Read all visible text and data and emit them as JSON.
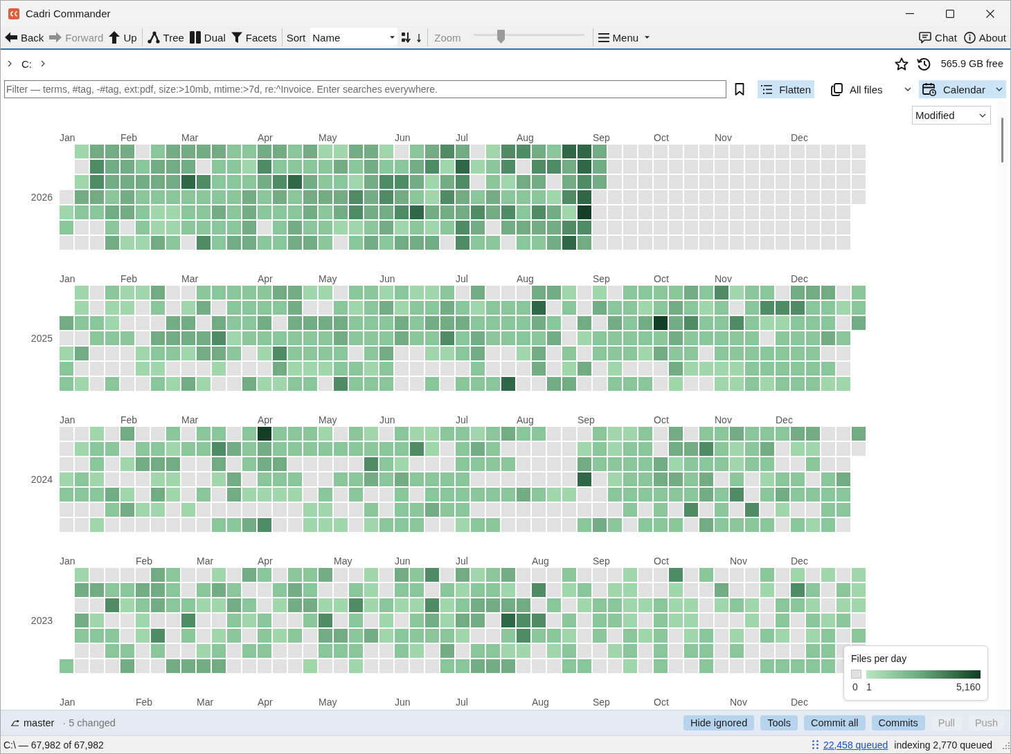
{
  "window": {
    "title": "Cadri Commander"
  },
  "toolbar": {
    "nav": [
      {
        "label": "Back",
        "disabled": false
      },
      {
        "label": "Forward",
        "disabled": true
      },
      {
        "label": "Up",
        "disabled": false
      }
    ],
    "views": [
      {
        "label": "Tree"
      },
      {
        "label": "Dual"
      },
      {
        "label": "Facets"
      }
    ],
    "sort": {
      "label": "Sort",
      "value": "Name"
    },
    "zoom": {
      "label": "Zoom",
      "disabled": true,
      "level": 0.23
    },
    "menu": {
      "label": "Menu"
    },
    "links": [
      {
        "label": "Chat"
      },
      {
        "label": "About"
      }
    ]
  },
  "location": {
    "path": [
      {
        "label": "C:"
      }
    ],
    "free_space": "565.9 GB free"
  },
  "filter": {
    "placeholder": "Filter — terms, #tag, -#tag, ext:pdf, size:>10mb, mtime:>7d, re:^Invoice. Enter searches everywhere."
  },
  "options": [
    {
      "kind": "toggle",
      "label": "Flatten",
      "on": true
    },
    {
      "kind": "dropdown",
      "label": "All files",
      "on": false
    },
    {
      "kind": "dropdown",
      "label": "Calendar",
      "on": true
    }
  ],
  "calendar": {
    "date_field": "Modified",
    "years": [
      {
        "year": "2026",
        "months": [
          "Jan",
          "Feb",
          "Mar",
          "Apr",
          "May",
          "Jun",
          "Jul",
          "Aug",
          "Sep",
          "Oct",
          "Nov",
          "Dec"
        ]
      },
      {
        "year": "2025",
        "months": [
          "Jan",
          "Feb",
          "Mar",
          "Apr",
          "May",
          "Jun",
          "Jul",
          "Aug",
          "Sep",
          "Oct",
          "Nov",
          "Dec"
        ]
      },
      {
        "year": "2024",
        "months": [
          "Jan",
          "Feb",
          "Mar",
          "Apr",
          "May",
          "Jun",
          "Jul",
          "Aug",
          "Sep",
          "Oct",
          "Nov",
          "Dec"
        ]
      },
      {
        "year": "2023",
        "months": [
          "Jan",
          "Feb",
          "Mar",
          "Apr",
          "May",
          "Jun",
          "Jul",
          "Aug",
          "Sep",
          "Oct",
          "Nov",
          "Dec"
        ]
      },
      {
        "months": [
          "Jan",
          "Feb",
          "Mar",
          "Apr",
          "May",
          "Jun",
          "Jul",
          "Aug",
          "Sep",
          "Oct",
          "Nov",
          "Dec"
        ]
      }
    ],
    "legend": {
      "title": "Files per day",
      "empty_label": "0",
      "min_label": "1",
      "max_label": "5,160"
    }
  },
  "git_bar": {
    "branch": "master",
    "changes": "· 5 changed",
    "buttons": [
      {
        "label": "Hide ignored",
        "disabled": false
      },
      {
        "label": "Tools",
        "disabled": false
      },
      {
        "label": "Commit all",
        "disabled": false
      },
      {
        "label": "Commits",
        "disabled": false
      },
      {
        "label": "Pull",
        "disabled": true
      },
      {
        "label": "Push",
        "disabled": true
      }
    ]
  },
  "status_bar": {
    "summary": "C:\\ — 67,982 of 67,982",
    "queue": "22,458 queued",
    "indexing": "indexing 2,770 queued"
  }
}
